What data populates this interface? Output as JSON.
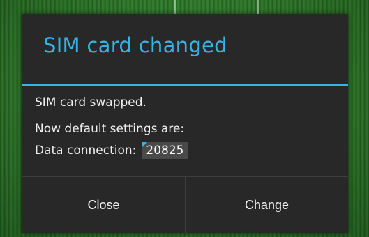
{
  "dialog": {
    "title": "SIM card changed",
    "message_line1": "SIM card swapped.",
    "message_line2": "Now default settings are:",
    "data_label": "Data connection:",
    "data_value": "20825",
    "buttons": {
      "close_label": "Close",
      "change_label": "Change"
    }
  },
  "colors": {
    "accent": "#33b5e5",
    "dialog_background": "#282828",
    "text": "#f0f0f0",
    "wallpaper": "#2f7a2a"
  }
}
